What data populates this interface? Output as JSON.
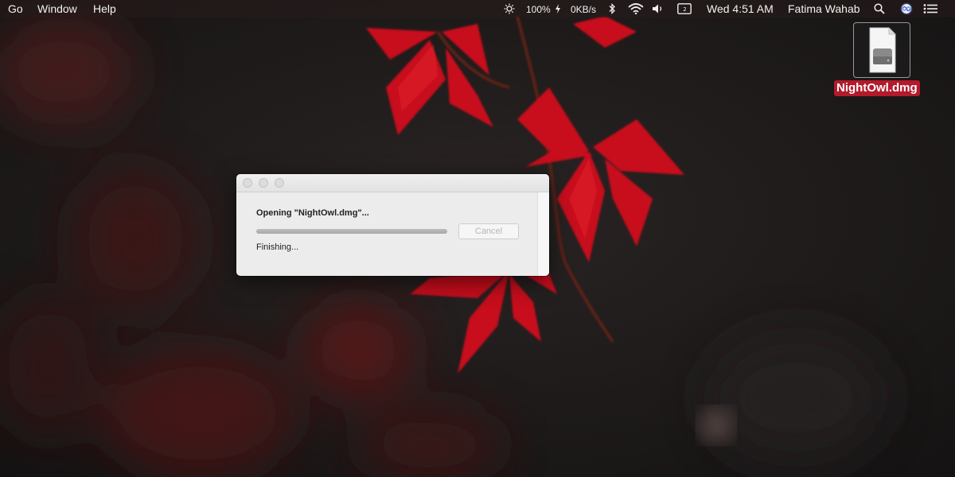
{
  "menubar": {
    "menus": [
      "Go",
      "Window",
      "Help"
    ],
    "battery": "100%",
    "network_speed": "0KB/s",
    "datetime": "Wed 4:51 AM",
    "user": "Fatima Wahab",
    "icons": [
      "brightness-icon",
      "battery-charging-icon",
      "bluetooth-icon",
      "wifi-icon",
      "volume-icon",
      "display-icon",
      "search-icon",
      "siri-icon",
      "notification-center-icon"
    ]
  },
  "desktop": {
    "file_name": "NightOwl.dmg",
    "file_icon": "disk-image-icon",
    "label_color": "#b31a2a"
  },
  "dialog": {
    "title": "Opening \"NightOwl.dmg\"...",
    "status": "Finishing...",
    "cancel_label": "Cancel",
    "progress": 1.0
  }
}
